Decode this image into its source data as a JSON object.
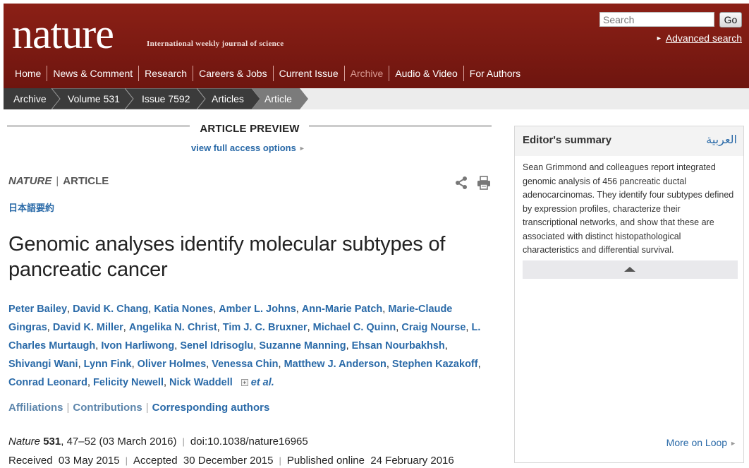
{
  "header": {
    "logo": "nature",
    "tagline": "International weekly journal of science",
    "search_placeholder": "Search",
    "go_label": "Go",
    "advanced_search": "Advanced search"
  },
  "nav": [
    "Home",
    "News & Comment",
    "Research",
    "Careers & Jobs",
    "Current Issue",
    "Archive",
    "Audio & Video",
    "For Authors"
  ],
  "breadcrumb": [
    "Archive",
    "Volume 531",
    "Issue 7592",
    "Articles",
    "Article"
  ],
  "preview": {
    "title": "ARTICLE PREVIEW",
    "full_access": "view full access options"
  },
  "article": {
    "journal": "NATURE",
    "type": "ARTICLE",
    "japanese_summary": "日本語要約",
    "title": "Genomic analyses identify molecular subtypes of pancreatic cancer",
    "authors": [
      "Peter Bailey",
      "David K. Chang",
      "Katia Nones",
      "Amber L. Johns",
      "Ann-Marie Patch",
      "Marie-Claude Gingras",
      "David K. Miller",
      "Angelika N. Christ",
      "Tim J. C. Bruxner",
      "Michael C. Quinn",
      "Craig Nourse",
      "L. Charles Murtaugh",
      "Ivon Harliwong",
      "Senel Idrisoglu",
      "Suzanne Manning",
      "Ehsan Nourbakhsh",
      "Shivangi Wani",
      "Lynn Fink",
      "Oliver Holmes",
      "Venessa Chin",
      "Matthew J. Anderson",
      "Stephen Kazakoff",
      "Conrad Leonard",
      "Felicity Newell",
      "Nick Waddell"
    ],
    "et_al": "et al.",
    "info_links": {
      "affiliations": "Affiliations",
      "contributions": "Contributions",
      "corresponding": "Corresponding authors"
    },
    "citation": {
      "journal": "Nature",
      "volume": "531",
      "pages": "47–52",
      "date": "(03 March 2016)",
      "doi": "doi:10.1038/nature16965"
    },
    "dates": {
      "received_label": "Received",
      "received": "03 May 2015",
      "accepted_label": "Accepted",
      "accepted": "30 December 2015",
      "published_label": "Published online",
      "published": "24 February 2016"
    }
  },
  "editors_summary": {
    "title": "Editor's summary",
    "arabic": "العربية",
    "text": "Sean Grimmond and colleagues report integrated genomic analysis of 456 pancreatic ductal adenocarcinomas. They identify four subtypes defined by expression profiles, characterize their transcriptional networks, and show that these are associated with distinct histopathological characteristics and differential survival.",
    "more_loop": "More on Loop"
  },
  "colors": {
    "masthead": "#7d1a13",
    "breadcrumb_dark": "#3b3b3b",
    "breadcrumb_light": "#7b7b7b",
    "link": "#2a6aa8"
  }
}
